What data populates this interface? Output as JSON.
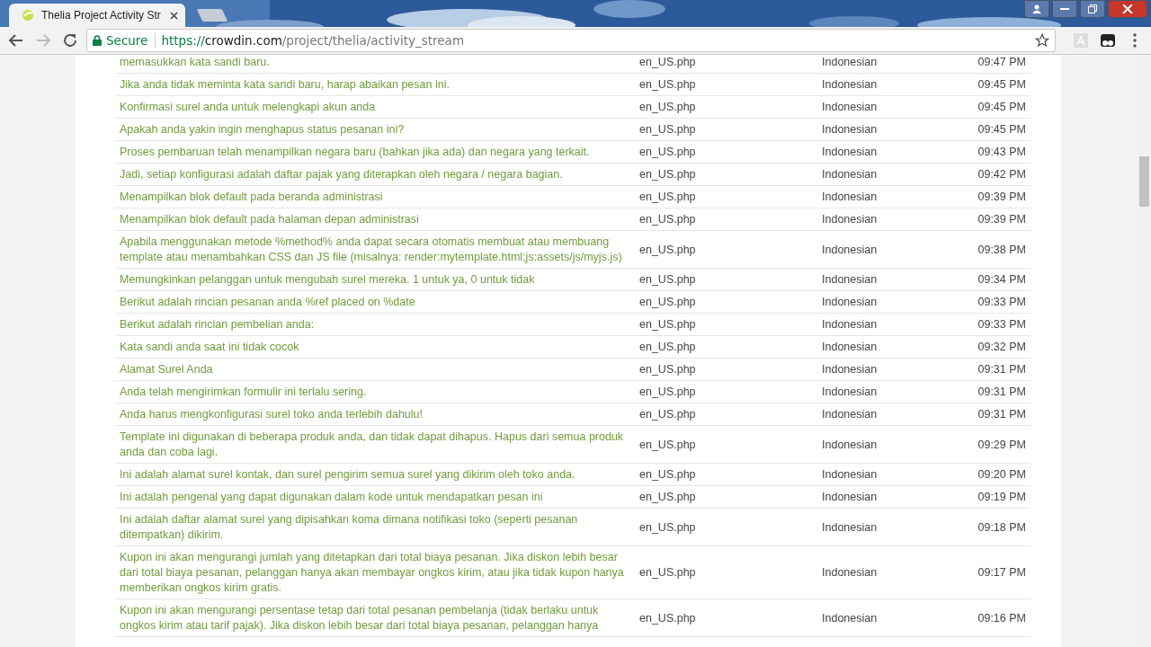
{
  "browser": {
    "tabs": [
      {
        "title": "Thelia Project Activity Str",
        "selected": true
      }
    ],
    "security": "Secure",
    "url": {
      "scheme": "https://",
      "host": "crowdin.com",
      "path": "/project/thelia/activity_stream"
    }
  },
  "rows": [
    {
      "text": "memasukkan kata sandi baru.",
      "file": "en_US.php",
      "language": "Indonesian",
      "time": "09:47 PM"
    },
    {
      "text": "Jika anda tidak meminta kata sandi baru, harap abaikan pesan ini.",
      "file": "en_US.php",
      "language": "Indonesian",
      "time": "09:45 PM"
    },
    {
      "text": "Konfirmasi surel anda untuk melengkapi akun anda",
      "file": "en_US.php",
      "language": "Indonesian",
      "time": "09:45 PM"
    },
    {
      "text": "Apakah anda yakin ingin menghapus status pesanan ini?",
      "file": "en_US.php",
      "language": "Indonesian",
      "time": "09:45 PM"
    },
    {
      "text": "Proses pembaruan telah menampilkan negara baru (bahkan jika ada) dan negara yang terkait.",
      "file": "en_US.php",
      "language": "Indonesian",
      "time": "09:43 PM"
    },
    {
      "text": "Jadi, setiap konfigurasi adalah daftar pajak yang diterapkan oleh negara / negara bagian.",
      "file": "en_US.php",
      "language": "Indonesian",
      "time": "09:42 PM"
    },
    {
      "text": "Menampilkan blok default pada beranda administrasi",
      "file": "en_US.php",
      "language": "Indonesian",
      "time": "09:39 PM"
    },
    {
      "text": "Menampilkan blok default pada halaman depan administrasi",
      "file": "en_US.php",
      "language": "Indonesian",
      "time": "09:39 PM"
    },
    {
      "text": "Apabila menggunakan metode %method% anda dapat secara otomatis membuat atau membuang template atau menambahkan CSS dan JS file (misalnya: render:mytemplate.html;js:assets/js/myjs.js)",
      "file": "en_US.php",
      "language": "Indonesian",
      "time": "09:38 PM"
    },
    {
      "text": "Memungkinkan pelanggan untuk mengubah surel mereka. 1 untuk ya, 0 untuk tidak",
      "file": "en_US.php",
      "language": "Indonesian",
      "time": "09:34 PM"
    },
    {
      "text": "Berikut adalah rincian pesanan anda %ref placed on %date",
      "file": "en_US.php",
      "language": "Indonesian",
      "time": "09:33 PM"
    },
    {
      "text": "Berikut adalah rincian pembelian anda:",
      "file": "en_US.php",
      "language": "Indonesian",
      "time": "09:33 PM"
    },
    {
      "text": "Kata sandi anda saat ini tidak cocok",
      "file": "en_US.php",
      "language": "Indonesian",
      "time": "09:32 PM"
    },
    {
      "text": "Alamat Surel Anda",
      "file": "en_US.php",
      "language": "Indonesian",
      "time": "09:31 PM"
    },
    {
      "text": "Anda telah mengirimkan formulir ini terlalu sering.",
      "file": "en_US.php",
      "language": "Indonesian",
      "time": "09:31 PM"
    },
    {
      "text": "Anda harus mengkonfigurasi surel toko anda terlebih dahulu!",
      "file": "en_US.php",
      "language": "Indonesian",
      "time": "09:31 PM"
    },
    {
      "text": "Template ini digunakan di beberapa produk anda, dan tidak dapat dihapus. Hapus dari semua produk anda dan coba lagi.",
      "file": "en_US.php",
      "language": "Indonesian",
      "time": "09:29 PM"
    },
    {
      "text": "Ini adalah alamat surel kontak, dan surel pengirim semua surel yang dikirim oleh toko anda.",
      "file": "en_US.php",
      "language": "Indonesian",
      "time": "09:20 PM"
    },
    {
      "text": "Ini adalah pengenal yang dapat digunakan dalam kode untuk mendapatkan pesan ini",
      "file": "en_US.php",
      "language": "Indonesian",
      "time": "09:19 PM"
    },
    {
      "text": "Ini adalah daftar alamat surel yang dipisahkan koma dimana notifikasi toko (seperti pesanan ditempatkan) dikirim.",
      "file": "en_US.php",
      "language": "Indonesian",
      "time": "09:18 PM"
    },
    {
      "text": "Kupon ini akan mengurangi jumlah yang ditetapkan dari total biaya pesanan. Jika diskon lebih besar dari total biaya pesanan, pelanggan hanya akan membayar ongkos kirim, atau jika tidak kupon hanya memberikan ongkos kirim gratis.",
      "file": "en_US.php",
      "language": "Indonesian",
      "time": "09:17 PM"
    },
    {
      "text": "Kupon ini akan mengurangi persentase tetap dari total pesanan pembelanja (tidak berlaku untuk ongkos kirim atau tarif pajak). Jika diskon lebih besar dari total biaya pesanan, pelanggan hanya",
      "file": "en_US.php",
      "language": "Indonesian",
      "time": "09:16 PM"
    }
  ]
}
